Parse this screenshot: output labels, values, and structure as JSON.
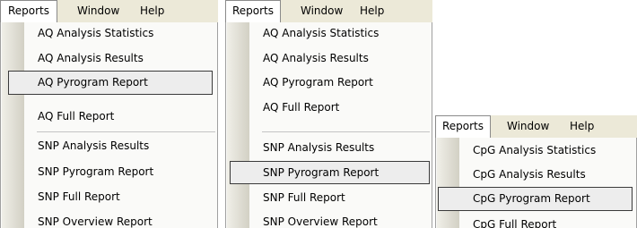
{
  "menubar": {
    "reports": "Reports",
    "window": "Window",
    "help": "Help"
  },
  "panel1": {
    "items": [
      "AQ Analysis Statistics",
      "AQ Analysis Results",
      "AQ Pyrogram Report",
      "AQ Full Report",
      "SNP Analysis Results",
      "SNP Pyrogram Report",
      "SNP Full Report",
      "SNP Overview Report"
    ],
    "highlighted": "AQ Pyrogram Report"
  },
  "panel2": {
    "items": [
      "AQ Analysis Statistics",
      "AQ Analysis Results",
      "AQ Pyrogram Report",
      "AQ Full Report",
      "SNP Analysis Results",
      "SNP Pyrogram Report",
      "SNP Full Report",
      "SNP Overview Report"
    ],
    "highlighted": "SNP Pyrogram Report"
  },
  "panel3": {
    "items": [
      "CpG Analysis Statistics",
      "CpG Analysis Results",
      "CpG Pyrogram Report",
      "CpG Full Report"
    ],
    "highlighted": "CpG Pyrogram Report"
  }
}
